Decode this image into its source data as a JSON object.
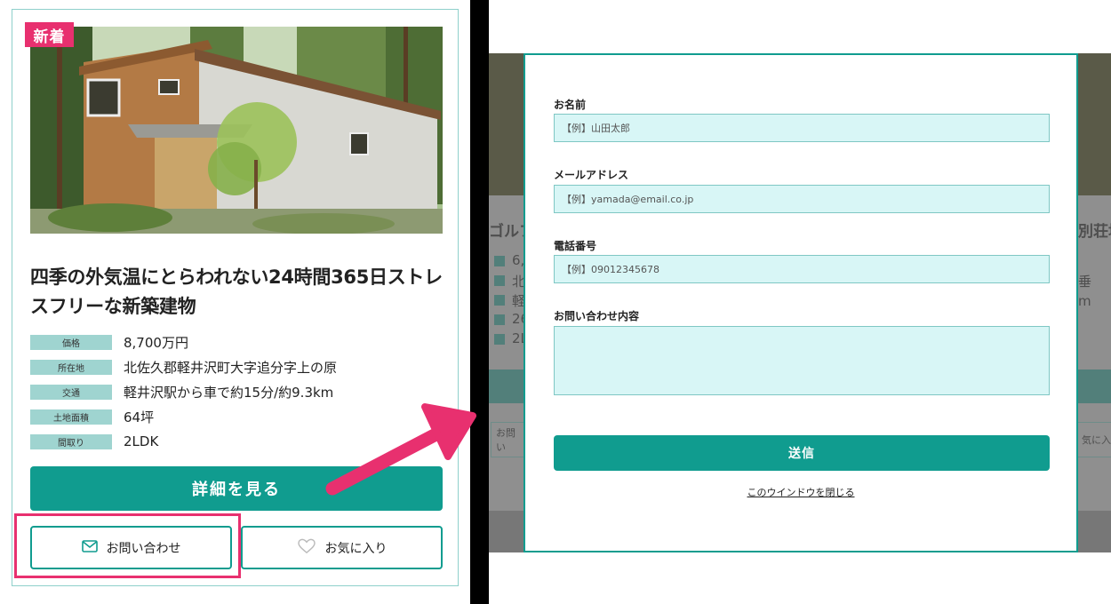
{
  "card": {
    "badge": "新着",
    "title": "四季の外気温にとらわれない24時間365日ストレスフリーな新築建物",
    "specs": [
      {
        "label": "価格",
        "value": "8,700万円"
      },
      {
        "label": "所在地",
        "value": "北佐久郡軽井沢町大字追分字上の原"
      },
      {
        "label": "交通",
        "value": "軽井沢駅から車で約15分/約9.3km"
      },
      {
        "label": "土地面積",
        "value": "64坪"
      },
      {
        "label": "間取り",
        "value": "2LDK"
      }
    ],
    "detail_button": "詳細を見る",
    "contact_button": "お問い合わせ",
    "favorite_button": "お気に入り"
  },
  "background_page": {
    "title_left": "ゴルフ",
    "title_right": "別荘地",
    "left_items": [
      "6,",
      "北",
      "軽",
      "26",
      "2L"
    ],
    "right_items": [
      "垂",
      "m"
    ],
    "left_button": "お問い",
    "right_button": "気に入"
  },
  "form": {
    "name_label": "お名前",
    "name_placeholder": "【例】山田太郎",
    "email_label": "メールアドレス",
    "email_placeholder": "【例】yamada@email.co.jp",
    "phone_label": "電話番号",
    "phone_placeholder": "【例】09012345678",
    "message_label": "お問い合わせ内容",
    "message_placeholder": "",
    "submit_label": "送信",
    "close_label": "このウインドウを閉じる"
  },
  "colors": {
    "accent": "#109c8f",
    "highlight": "#e8306f",
    "input_bg": "#d8f6f6",
    "spec_label_bg": "#9fd4d0"
  }
}
